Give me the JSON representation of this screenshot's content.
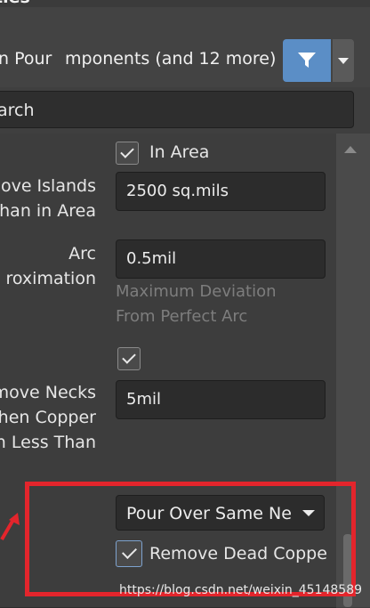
{
  "window": {
    "title_fragment": "ties",
    "pin_glyph": "⌖",
    "close_glyph": "✕"
  },
  "filter": {
    "scope_text": "n Pour",
    "objects_text": "mponents (and 12 more)",
    "button_icon": "filter-funnel-icon",
    "accent": "#5b8ec6"
  },
  "search": {
    "value": "arch"
  },
  "properties": {
    "in_area_label": "In Area",
    "remove_islands_label_1": "move Islands",
    "remove_islands_label_2": "han in Area",
    "remove_islands_value": "2500 sq.mils",
    "arc_label_1": "Arc",
    "arc_label_2": "roximation",
    "arc_value": "0.5mil",
    "arc_hint_1": "Maximum Deviation",
    "arc_hint_2": "From Perfect Arc",
    "remove_necks_label_1": "move Necks",
    "remove_necks_label_2": "hen Copper",
    "remove_necks_label_3": "n Less Than",
    "remove_necks_value": "5mil",
    "pour_mode_value": "Pour Over Same Ne",
    "remove_dead_copper_label": "Remove Dead Coppe"
  },
  "annotation": {
    "highlight_color": "#e3252c"
  },
  "watermark": "https://blog.csdn.net/weixin_45148589"
}
